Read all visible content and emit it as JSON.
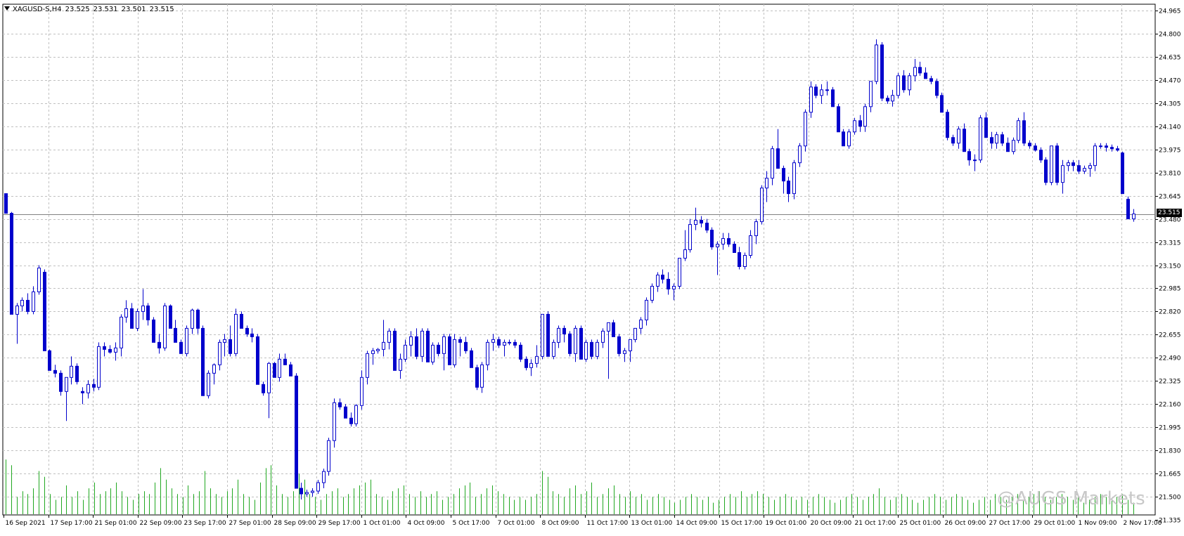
{
  "header": {
    "symbol": "XAGUSD-S,H4",
    "open": "23.525",
    "high": "23.531",
    "low": "23.501",
    "close": "23.515"
  },
  "price_tag": "23.515",
  "watermark": "@AUGS Markets",
  "colors": {
    "bear": "#0000cc",
    "bull_outline": "#0000cc",
    "bull_fill": "#ffffff",
    "volume": "#21a821",
    "grid": "#c0c0c0",
    "axis": "#000000"
  },
  "chart_data": {
    "type": "candlestick",
    "title": "",
    "grid": true,
    "ylim": [
      21.335,
      24.965
    ],
    "y_ticks": [
      "24.965",
      "24.800",
      "24.635",
      "24.470",
      "24.305",
      "24.140",
      "23.975",
      "23.810",
      "23.645",
      "23.480",
      "23.315",
      "23.150",
      "22.985",
      "22.820",
      "22.655",
      "22.490",
      "22.325",
      "22.160",
      "21.995",
      "21.830",
      "21.665",
      "21.500",
      "21.335"
    ],
    "x_ticks": [
      "16 Sep 2021",
      "17 Sep 17:00",
      "21 Sep 01:00",
      "22 Sep 09:00",
      "23 Sep 17:00",
      "27 Sep 01:00",
      "28 Sep 09:00",
      "29 Sep 17:00",
      "1 Oct 01:00",
      "4 Oct 09:00",
      "5 Oct 17:00",
      "7 Oct 01:00",
      "8 Oct 09:00",
      "11 Oct 17:00",
      "13 Oct 01:00",
      "14 Oct 09:00",
      "15 Oct 17:00",
      "19 Oct 01:00",
      "20 Oct 09:00",
      "21 Oct 17:00",
      "25 Oct 01:00",
      "26 Oct 09:00",
      "27 Oct 17:00",
      "29 Oct 01:00",
      "1 Nov 09:00",
      "2 Nov 17:00"
    ],
    "last_price": 23.515,
    "ohlc": [
      [
        23.66,
        23.66,
        23.52,
        23.52
      ],
      [
        23.52,
        23.53,
        22.8,
        22.8
      ],
      [
        22.8,
        22.88,
        22.59,
        22.86
      ],
      [
        22.86,
        22.92,
        22.82,
        22.9
      ],
      [
        22.9,
        22.95,
        22.8,
        22.82
      ],
      [
        22.82,
        23.0,
        22.8,
        22.96
      ],
      [
        22.96,
        23.15,
        22.94,
        23.13
      ],
      [
        23.1,
        23.12,
        22.54,
        22.54
      ],
      [
        22.54,
        22.55,
        22.4,
        22.4
      ],
      [
        22.4,
        22.44,
        22.35,
        22.38
      ],
      [
        22.38,
        22.4,
        22.22,
        22.25
      ],
      [
        22.25,
        22.35,
        22.04,
        22.35
      ],
      [
        22.35,
        22.5,
        22.3,
        22.43
      ],
      [
        22.43,
        22.45,
        22.3,
        22.32
      ],
      [
        22.25,
        22.28,
        22.16,
        22.24
      ],
      [
        22.24,
        22.33,
        22.2,
        22.3
      ],
      [
        22.3,
        22.34,
        22.25,
        22.28
      ],
      [
        22.28,
        22.6,
        22.26,
        22.57
      ],
      [
        22.57,
        22.6,
        22.5,
        22.55
      ],
      [
        22.55,
        22.58,
        22.52,
        22.53
      ],
      [
        22.53,
        22.6,
        22.47,
        22.56
      ],
      [
        22.56,
        22.8,
        22.5,
        22.78
      ],
      [
        22.78,
        22.9,
        22.74,
        22.84
      ],
      [
        22.84,
        22.88,
        22.7,
        22.7
      ],
      [
        22.7,
        22.84,
        22.68,
        22.82
      ],
      [
        22.82,
        22.98,
        22.76,
        22.86
      ],
      [
        22.86,
        22.88,
        22.72,
        22.76
      ],
      [
        22.76,
        22.78,
        22.62,
        22.6
      ],
      [
        22.6,
        22.66,
        22.52,
        22.56
      ],
      [
        22.56,
        22.88,
        22.54,
        22.86
      ],
      [
        22.86,
        22.87,
        22.7,
        22.7
      ],
      [
        22.7,
        22.76,
        22.6,
        22.6
      ],
      [
        22.6,
        22.62,
        22.52,
        22.52
      ],
      [
        22.52,
        22.72,
        22.5,
        22.7
      ],
      [
        22.7,
        22.84,
        22.66,
        22.83
      ],
      [
        22.83,
        22.84,
        22.66,
        22.7
      ],
      [
        22.7,
        22.72,
        22.22,
        22.22
      ],
      [
        22.22,
        22.4,
        22.2,
        22.38
      ],
      [
        22.38,
        22.45,
        22.3,
        22.44
      ],
      [
        22.44,
        22.62,
        22.4,
        22.6
      ],
      [
        22.6,
        22.66,
        22.5,
        22.62
      ],
      [
        22.62,
        22.72,
        22.5,
        22.52
      ],
      [
        22.52,
        22.84,
        22.5,
        22.8
      ],
      [
        22.8,
        22.82,
        22.7,
        22.7
      ],
      [
        22.7,
        22.72,
        22.64,
        22.66
      ],
      [
        22.66,
        22.7,
        22.6,
        22.64
      ],
      [
        22.64,
        22.66,
        22.3,
        22.3
      ],
      [
        22.3,
        22.32,
        22.22,
        22.24
      ],
      [
        22.24,
        22.46,
        22.06,
        22.45
      ],
      [
        22.45,
        22.46,
        22.35,
        22.35
      ],
      [
        22.35,
        22.52,
        22.32,
        22.48
      ],
      [
        22.48,
        22.52,
        22.44,
        22.44
      ],
      [
        22.44,
        22.46,
        22.36,
        22.36
      ],
      [
        22.36,
        22.38,
        21.56,
        21.56
      ],
      [
        21.56,
        21.6,
        21.48,
        21.52
      ],
      [
        21.52,
        21.55,
        21.5,
        21.53
      ],
      [
        21.53,
        21.56,
        21.5,
        21.54
      ],
      [
        21.54,
        21.62,
        21.52,
        21.6
      ],
      [
        21.6,
        21.7,
        21.56,
        21.68
      ],
      [
        21.68,
        21.92,
        21.65,
        21.9
      ],
      [
        21.9,
        22.2,
        21.85,
        22.17
      ],
      [
        22.17,
        22.2,
        22.12,
        22.14
      ],
      [
        22.14,
        22.16,
        22.06,
        22.06
      ],
      [
        22.06,
        22.1,
        22.0,
        22.02
      ],
      [
        22.02,
        22.16,
        22.0,
        22.15
      ],
      [
        22.15,
        22.4,
        22.12,
        22.35
      ],
      [
        22.35,
        22.54,
        22.3,
        22.52
      ],
      [
        22.52,
        22.56,
        22.44,
        22.54
      ],
      [
        22.54,
        22.56,
        22.52,
        22.55
      ],
      [
        22.55,
        22.76,
        22.5,
        22.6
      ],
      [
        22.6,
        22.7,
        22.55,
        22.68
      ],
      [
        22.68,
        22.7,
        22.4,
        22.4
      ],
      [
        22.4,
        22.52,
        22.34,
        22.48
      ],
      [
        22.48,
        22.62,
        22.46,
        22.58
      ],
      [
        22.58,
        22.68,
        22.5,
        22.64
      ],
      [
        22.64,
        22.7,
        22.48,
        22.5
      ],
      [
        22.5,
        22.7,
        22.46,
        22.68
      ],
      [
        22.68,
        22.7,
        22.46,
        22.46
      ],
      [
        22.46,
        22.6,
        22.44,
        22.58
      ],
      [
        22.58,
        22.6,
        22.5,
        22.52
      ],
      [
        22.52,
        22.66,
        22.4,
        22.64
      ],
      [
        22.64,
        22.66,
        22.44,
        22.44
      ],
      [
        22.44,
        22.66,
        22.42,
        22.62
      ],
      [
        22.62,
        22.64,
        22.5,
        22.6
      ],
      [
        22.6,
        22.64,
        22.52,
        22.54
      ],
      [
        22.54,
        22.56,
        22.42,
        22.42
      ],
      [
        22.42,
        22.44,
        22.26,
        22.28
      ],
      [
        22.28,
        22.46,
        22.24,
        22.44
      ],
      [
        22.44,
        22.62,
        22.4,
        22.6
      ],
      [
        22.6,
        22.66,
        22.54,
        22.62
      ],
      [
        22.62,
        22.64,
        22.56,
        22.58
      ],
      [
        22.58,
        22.62,
        22.5,
        22.6
      ],
      [
        22.6,
        22.62,
        22.58,
        22.6
      ],
      [
        22.6,
        22.62,
        22.56,
        22.58
      ],
      [
        22.58,
        22.6,
        22.46,
        22.48
      ],
      [
        22.48,
        22.5,
        22.4,
        22.42
      ],
      [
        22.42,
        22.48,
        22.36,
        22.45
      ],
      [
        22.45,
        22.58,
        22.42,
        22.5
      ],
      [
        22.5,
        22.8,
        22.48,
        22.8
      ],
      [
        22.8,
        22.82,
        22.5,
        22.5
      ],
      [
        22.5,
        22.62,
        22.48,
        22.6
      ],
      [
        22.6,
        22.72,
        22.56,
        22.7
      ],
      [
        22.7,
        22.72,
        22.6,
        22.66
      ],
      [
        22.66,
        22.68,
        22.5,
        22.52
      ],
      [
        22.52,
        22.72,
        22.46,
        22.7
      ],
      [
        22.7,
        22.72,
        22.48,
        22.48
      ],
      [
        22.48,
        22.62,
        22.46,
        22.6
      ],
      [
        22.6,
        22.62,
        22.48,
        22.5
      ],
      [
        22.5,
        22.62,
        22.48,
        22.6
      ],
      [
        22.6,
        22.7,
        22.56,
        22.68
      ],
      [
        22.68,
        22.72,
        22.34,
        22.74
      ],
      [
        22.74,
        22.76,
        22.64,
        22.64
      ],
      [
        22.64,
        22.66,
        22.5,
        22.52
      ],
      [
        22.52,
        22.56,
        22.46,
        22.54
      ],
      [
        22.54,
        22.6,
        22.46,
        22.62
      ],
      [
        22.62,
        22.7,
        22.6,
        22.7
      ],
      [
        22.7,
        22.78,
        22.66,
        22.76
      ],
      [
        22.76,
        22.92,
        22.72,
        22.9
      ],
      [
        22.9,
        23.02,
        22.88,
        23.0
      ],
      [
        23.0,
        23.1,
        22.96,
        23.08
      ],
      [
        23.08,
        23.12,
        23.02,
        23.05
      ],
      [
        23.05,
        23.1,
        22.94,
        22.98
      ],
      [
        22.98,
        23.02,
        22.9,
        23.0
      ],
      [
        23.0,
        23.2,
        22.98,
        23.2
      ],
      [
        23.2,
        23.4,
        23.18,
        23.26
      ],
      [
        23.26,
        23.48,
        23.24,
        23.44
      ],
      [
        23.44,
        23.56,
        23.4,
        23.47
      ],
      [
        23.47,
        23.5,
        23.42,
        23.45
      ],
      [
        23.45,
        23.48,
        23.38,
        23.4
      ],
      [
        23.4,
        23.42,
        23.26,
        23.28
      ],
      [
        23.28,
        23.32,
        23.08,
        23.3
      ],
      [
        23.3,
        23.38,
        23.26,
        23.34
      ],
      [
        23.34,
        23.38,
        23.28,
        23.3
      ],
      [
        23.3,
        23.32,
        23.24,
        23.24
      ],
      [
        23.24,
        23.28,
        23.12,
        23.14
      ],
      [
        23.14,
        23.24,
        23.12,
        23.22
      ],
      [
        23.22,
        23.4,
        23.2,
        23.36
      ],
      [
        23.36,
        23.48,
        23.3,
        23.46
      ],
      [
        23.46,
        23.72,
        23.44,
        23.7
      ],
      [
        23.7,
        23.82,
        23.6,
        23.77
      ],
      [
        23.77,
        24.0,
        23.72,
        23.98
      ],
      [
        23.98,
        24.12,
        23.84,
        23.84
      ],
      [
        23.84,
        23.86,
        23.66,
        23.75
      ],
      [
        23.75,
        23.78,
        23.6,
        23.66
      ],
      [
        23.66,
        23.9,
        23.62,
        23.88
      ],
      [
        23.88,
        24.02,
        23.85,
        24.0
      ],
      [
        24.0,
        24.26,
        23.96,
        24.24
      ],
      [
        24.24,
        24.46,
        24.2,
        24.42
      ],
      [
        24.42,
        24.44,
        24.34,
        24.36
      ],
      [
        24.36,
        24.44,
        24.3,
        24.4
      ],
      [
        24.4,
        24.46,
        24.36,
        24.4
      ],
      [
        24.4,
        24.42,
        24.28,
        24.28
      ],
      [
        24.28,
        24.3,
        24.1,
        24.1
      ],
      [
        24.1,
        24.12,
        24.0,
        24.0
      ],
      [
        24.0,
        24.12,
        23.98,
        24.1
      ],
      [
        24.1,
        24.2,
        24.08,
        24.18
      ],
      [
        24.18,
        24.22,
        24.1,
        24.14
      ],
      [
        24.14,
        24.3,
        24.1,
        24.28
      ],
      [
        24.28,
        24.46,
        24.24,
        24.46
      ],
      [
        24.46,
        24.76,
        24.44,
        24.72
      ],
      [
        24.72,
        24.74,
        24.32,
        24.34
      ],
      [
        24.34,
        24.36,
        24.3,
        24.32
      ],
      [
        24.32,
        24.4,
        24.28,
        24.36
      ],
      [
        24.36,
        24.52,
        24.34,
        24.5
      ],
      [
        24.5,
        24.54,
        24.38,
        24.4
      ],
      [
        24.4,
        24.52,
        24.36,
        24.5
      ],
      [
        24.5,
        24.62,
        24.46,
        24.56
      ],
      [
        24.56,
        24.6,
        24.5,
        24.52
      ],
      [
        24.52,
        24.56,
        24.48,
        24.48
      ],
      [
        24.48,
        24.5,
        24.44,
        24.46
      ],
      [
        24.46,
        24.48,
        24.34,
        24.36
      ],
      [
        24.36,
        24.38,
        24.24,
        24.24
      ],
      [
        24.24,
        24.26,
        24.04,
        24.06
      ],
      [
        24.06,
        24.08,
        24.0,
        24.02
      ],
      [
        24.02,
        24.14,
        23.98,
        24.12
      ],
      [
        24.12,
        24.16,
        23.96,
        23.96
      ],
      [
        23.96,
        23.98,
        23.86,
        23.9
      ],
      [
        23.9,
        23.94,
        23.82,
        23.9
      ],
      [
        23.9,
        24.22,
        23.88,
        24.2
      ],
      [
        24.2,
        24.24,
        24.06,
        24.06
      ],
      [
        24.06,
        24.1,
        23.98,
        24.02
      ],
      [
        24.02,
        24.1,
        23.98,
        24.08
      ],
      [
        24.08,
        24.1,
        24.0,
        24.02
      ],
      [
        24.02,
        24.06,
        23.96,
        23.96
      ],
      [
        23.96,
        24.06,
        23.94,
        24.04
      ],
      [
        24.04,
        24.2,
        24.02,
        24.18
      ],
      [
        24.18,
        24.24,
        24.0,
        24.02
      ],
      [
        24.02,
        24.04,
        23.98,
        24.0
      ],
      [
        24.0,
        24.02,
        23.96,
        23.97
      ],
      [
        23.97,
        23.99,
        23.88,
        23.9
      ],
      [
        23.9,
        23.92,
        23.72,
        23.74
      ],
      [
        23.74,
        24.0,
        23.72,
        24.0
      ],
      [
        24.0,
        24.02,
        23.72,
        23.74
      ],
      [
        23.74,
        23.9,
        23.66,
        23.86
      ],
      [
        23.86,
        23.9,
        23.82,
        23.88
      ],
      [
        23.88,
        23.9,
        23.82,
        23.86
      ],
      [
        23.86,
        23.9,
        23.8,
        23.82
      ],
      [
        23.82,
        23.86,
        23.8,
        23.84
      ],
      [
        23.84,
        23.88,
        23.78,
        23.86
      ],
      [
        23.86,
        24.02,
        23.82,
        24.0
      ],
      [
        24.0,
        24.02,
        23.98,
        24.0
      ],
      [
        24.0,
        24.02,
        23.96,
        23.99
      ],
      [
        23.99,
        24.01,
        23.96,
        23.98
      ],
      [
        23.98,
        24.0,
        23.96,
        23.97
      ],
      [
        23.95,
        23.96,
        23.66,
        23.66
      ],
      [
        23.62,
        23.64,
        23.48,
        23.48
      ],
      [
        23.48,
        23.55,
        23.46,
        23.515
      ]
    ],
    "volume": [
      0.95,
      0.85,
      0.3,
      0.4,
      0.35,
      0.45,
      0.75,
      0.65,
      0.35,
      0.25,
      0.3,
      0.5,
      0.3,
      0.4,
      0.25,
      0.45,
      0.55,
      0.35,
      0.4,
      0.45,
      0.55,
      0.4,
      0.3,
      0.25,
      0.35,
      0.4,
      0.35,
      0.55,
      0.8,
      0.6,
      0.45,
      0.35,
      0.3,
      0.5,
      0.35,
      0.4,
      0.75,
      0.45,
      0.35,
      0.3,
      0.4,
      0.45,
      0.6,
      0.35,
      0.3,
      0.25,
      0.55,
      0.8,
      0.85,
      0.5,
      0.35,
      0.3,
      0.4,
      0.7,
      0.6,
      0.35,
      0.3,
      0.25,
      0.35,
      0.4,
      0.45,
      0.3,
      0.35,
      0.45,
      0.5,
      0.55,
      0.6,
      0.35,
      0.3,
      0.25,
      0.4,
      0.45,
      0.5,
      0.35,
      0.3,
      0.4,
      0.3,
      0.35,
      0.4,
      0.25,
      0.3,
      0.35,
      0.45,
      0.5,
      0.55,
      0.3,
      0.35,
      0.45,
      0.5,
      0.4,
      0.35,
      0.3,
      0.25,
      0.3,
      0.25,
      0.3,
      0.35,
      0.75,
      0.65,
      0.4,
      0.35,
      0.3,
      0.45,
      0.5,
      0.35,
      0.4,
      0.55,
      0.3,
      0.35,
      0.45,
      0.5,
      0.35,
      0.3,
      0.4,
      0.3,
      0.35,
      0.25,
      0.3,
      0.35,
      0.3,
      0.25,
      0.2,
      0.25,
      0.3,
      0.35,
      0.3,
      0.25,
      0.3,
      0.2,
      0.25,
      0.3,
      0.35,
      0.3,
      0.4,
      0.3,
      0.35,
      0.4,
      0.35,
      0.3,
      0.25,
      0.3,
      0.35,
      0.3,
      0.25,
      0.3,
      0.25,
      0.3,
      0.35,
      0.3,
      0.25,
      0.2,
      0.25,
      0.3,
      0.35,
      0.3,
      0.25,
      0.3,
      0.35,
      0.45,
      0.3,
      0.25,
      0.3,
      0.35,
      0.3,
      0.25,
      0.2,
      0.25,
      0.3,
      0.35,
      0.3,
      0.25,
      0.3,
      0.35,
      0.3,
      0.25,
      0.2,
      0.25,
      0.3,
      0.25,
      0.35,
      0.3,
      0.25,
      0.3,
      0.35,
      0.25,
      0.3,
      0.35,
      0.4,
      0.3,
      0.25,
      0.3,
      0.35,
      0.3,
      0.25,
      0.3,
      0.2,
      0.25,
      0.3,
      0.35,
      0.3,
      0.25,
      0.3,
      0.35,
      0.25,
      0.2
    ]
  }
}
